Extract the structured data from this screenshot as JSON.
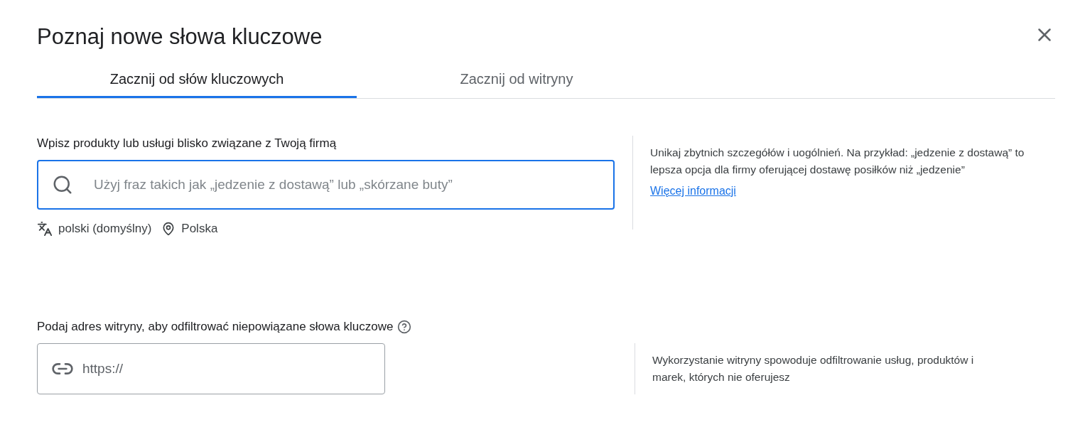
{
  "dialog": {
    "title": "Poznaj nowe słowa kluczowe"
  },
  "tabs": [
    {
      "label": "Zacznij od słów kluczowych",
      "selected": true
    },
    {
      "label": "Zacznij od witryny",
      "selected": false
    }
  ],
  "keywords_section": {
    "label": "Wpisz produkty lub usługi blisko związane z Twoją firmą",
    "placeholder": "Użyj fraz takich jak „jedzenie z dostawą” lub „skórzane buty”",
    "focused": true,
    "language": "polski (domyślny)",
    "location": "Polska",
    "hint": "Unikaj zbytnich szczegółów i uogólnień. Na przykład: „jedzenie z dostawą” to lepsza opcja dla firmy oferującej dostawę posiłków niż „jedzenie”",
    "link": "Więcej informacji"
  },
  "website_section": {
    "label": "Podaj adres witryny, aby odfiltrować niepowiązane słowa kluczowe",
    "placeholder": "https://",
    "focused": false,
    "hint": "Wykorzystanie witryny spowoduje odfiltrowanie usług, produktów i marek, których nie oferujesz"
  }
}
